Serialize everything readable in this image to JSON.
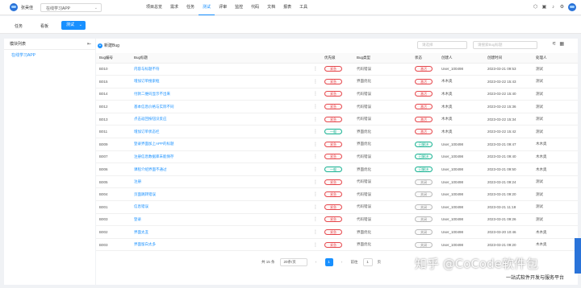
{
  "topbar": {
    "user_name": "张昊佳",
    "project": "在线学习APP",
    "nav": [
      "项目总览",
      "需求",
      "任务",
      "测试",
      "评审",
      "监控",
      "代码",
      "文档",
      "报表",
      "工具"
    ],
    "active_nav": "测试"
  },
  "subbar": {
    "tabs": [
      "任务",
      "看板"
    ],
    "test_button": "测试"
  },
  "leftpanel": {
    "title": "模块列表",
    "items": [
      "在线学习APP"
    ]
  },
  "main": {
    "new_bug": "新建Bug",
    "filter1_placeholder": "请选择",
    "filter2_placeholder": "请搜索Bug标题",
    "columns": [
      "Bug编号",
      "Bug标题",
      "",
      "优先级",
      "Bug类型",
      "状态",
      "创建人",
      "创建时间",
      "处理人"
    ],
    "rows": [
      {
        "id": "B010",
        "title": "内容与标题不符",
        "priority": "紧急",
        "pcolor": "red",
        "type": "代码错误",
        "status": "激活",
        "scolor": "red",
        "creator": "User_100498",
        "time": "2023-03-21 09:53",
        "handler": "测试"
      },
      {
        "id": "B015",
        "title": "增加订单搜索框",
        "priority": "紧急",
        "pcolor": "red",
        "type": "界面优化",
        "status": "激活",
        "scolor": "red",
        "creator": "木木奥",
        "time": "2023-03-22 15:43",
        "handler": "测试"
      },
      {
        "id": "B014",
        "title": "付款二维码显示不出来",
        "priority": "紧急",
        "pcolor": "red",
        "type": "代码错误",
        "status": "激活",
        "scolor": "red",
        "creator": "木木奥",
        "time": "2023-03-22 15:40",
        "handler": "测试"
      },
      {
        "id": "B012",
        "title": "基本信息价格与实际不同",
        "priority": "紧急",
        "pcolor": "red",
        "type": "代码错误",
        "status": "激活",
        "scolor": "red",
        "creator": "木木奥",
        "time": "2023-03-22 15:36",
        "handler": "测试"
      },
      {
        "id": "B013",
        "title": "点击返回按钮没反应",
        "priority": "紧急",
        "pcolor": "red",
        "type": "代码错误",
        "status": "激活",
        "scolor": "red",
        "creator": "木木奥",
        "time": "2023-03-22 15:34",
        "handler": "测试"
      },
      {
        "id": "B011",
        "title": "增加订单状态栏",
        "priority": "一般",
        "pcolor": "teal",
        "type": "界面优化",
        "status": "激活",
        "scolor": "red",
        "creator": "木木奥",
        "time": "2023-03-22 15:42",
        "handler": "测试"
      },
      {
        "id": "B009",
        "title": "登录界面加上APP的标题",
        "priority": "紧急",
        "pcolor": "red",
        "type": "界面优化",
        "status": "已解决",
        "scolor": "teal",
        "creator": "User_100498",
        "time": "2023-03-21 09:47",
        "handler": "木木奥"
      },
      {
        "id": "B007",
        "title": "注册信息数据库未能保存",
        "priority": "紧急",
        "pcolor": "red",
        "type": "代码错误",
        "status": "已解决",
        "scolor": "teal",
        "creator": "User_100498",
        "time": "2023-03-21 09:40",
        "handler": "木木奥"
      },
      {
        "id": "B006",
        "title": "课程介绍界面不通过",
        "priority": "一般",
        "pcolor": "teal",
        "type": "界面优化",
        "status": "已解决",
        "scolor": "teal",
        "creator": "User_100498",
        "time": "2023-03-21 09:50",
        "handler": "木木奥"
      },
      {
        "id": "B005",
        "title": "注册",
        "priority": "紧急",
        "pcolor": "red",
        "type": "代码错误",
        "status": "关闭",
        "scolor": "gray",
        "creator": "User_100498",
        "time": "2023-03-21 09:24",
        "handler": "测试"
      },
      {
        "id": "B004",
        "title": "页面跳转错误",
        "priority": "紧急",
        "pcolor": "red",
        "type": "代码错误",
        "status": "关闭",
        "scolor": "gray",
        "creator": "User_100498",
        "time": "2023-03-21 09:20",
        "handler": "测试"
      },
      {
        "id": "B001",
        "title": "信息错误",
        "priority": "紧急",
        "pcolor": "red",
        "type": "代码错误",
        "status": "关闭",
        "scolor": "gray",
        "creator": "User_100498",
        "time": "2023-03-21 11:18",
        "handler": "测试"
      },
      {
        "id": "B003",
        "title": "登录",
        "priority": "紧急",
        "pcolor": "red",
        "type": "代码错误",
        "status": "关闭",
        "scolor": "gray",
        "creator": "User_100498",
        "time": "2023-03-21 09:26",
        "handler": "测试"
      },
      {
        "id": "B002",
        "title": "界面太丑",
        "priority": "紧急",
        "pcolor": "red",
        "type": "界面优化",
        "status": "关闭",
        "scolor": "gray",
        "creator": "User_100498",
        "time": "2023-03-20 10:46",
        "handler": "木木奥"
      },
      {
        "id": "B003",
        "title": "界面留白太多",
        "priority": "紧急",
        "pcolor": "red",
        "type": "界面优化",
        "status": "关闭",
        "scolor": "gray",
        "creator": "User_100498",
        "time": "2023-03-21 09:20",
        "handler": "木木奥"
      }
    ]
  },
  "pager": {
    "total": "共 15 条",
    "page_size": "20条/页",
    "current": "1",
    "goto_label": "前往",
    "goto_value": "1",
    "page_suffix": "页"
  },
  "watermark": {
    "text": "知乎 @CoCode软件包",
    "brand": "CoCode",
    "sub": "一站式软件开发与服务平台"
  }
}
